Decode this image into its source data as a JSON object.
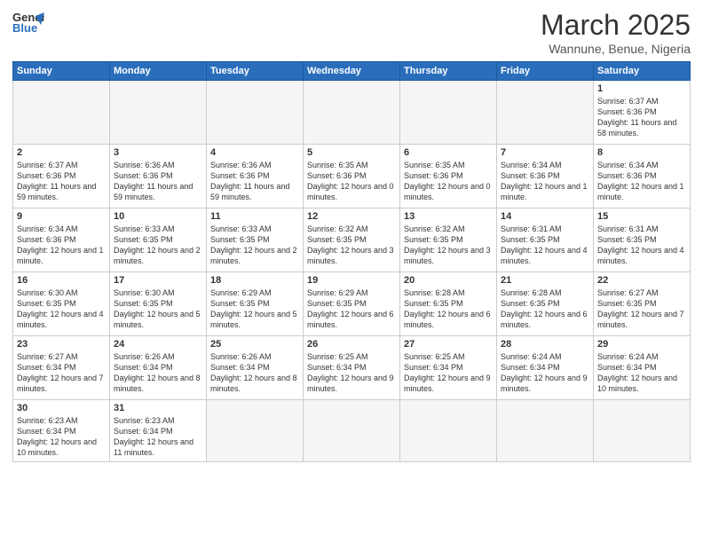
{
  "header": {
    "logo_general": "General",
    "logo_blue": "Blue",
    "month_year": "March 2025",
    "location": "Wannune, Benue, Nigeria"
  },
  "days_of_week": [
    "Sunday",
    "Monday",
    "Tuesday",
    "Wednesday",
    "Thursday",
    "Friday",
    "Saturday"
  ],
  "weeks": [
    [
      {
        "day": "",
        "info": ""
      },
      {
        "day": "",
        "info": ""
      },
      {
        "day": "",
        "info": ""
      },
      {
        "day": "",
        "info": ""
      },
      {
        "day": "",
        "info": ""
      },
      {
        "day": "",
        "info": ""
      },
      {
        "day": "1",
        "info": "Sunrise: 6:37 AM\nSunset: 6:36 PM\nDaylight: 11 hours\nand 58 minutes."
      }
    ],
    [
      {
        "day": "2",
        "info": "Sunrise: 6:37 AM\nSunset: 6:36 PM\nDaylight: 11 hours\nand 59 minutes."
      },
      {
        "day": "3",
        "info": "Sunrise: 6:36 AM\nSunset: 6:36 PM\nDaylight: 11 hours\nand 59 minutes."
      },
      {
        "day": "4",
        "info": "Sunrise: 6:36 AM\nSunset: 6:36 PM\nDaylight: 11 hours\nand 59 minutes."
      },
      {
        "day": "5",
        "info": "Sunrise: 6:35 AM\nSunset: 6:36 PM\nDaylight: 12 hours\nand 0 minutes."
      },
      {
        "day": "6",
        "info": "Sunrise: 6:35 AM\nSunset: 6:36 PM\nDaylight: 12 hours\nand 0 minutes."
      },
      {
        "day": "7",
        "info": "Sunrise: 6:34 AM\nSunset: 6:36 PM\nDaylight: 12 hours\nand 1 minute."
      },
      {
        "day": "8",
        "info": "Sunrise: 6:34 AM\nSunset: 6:36 PM\nDaylight: 12 hours\nand 1 minute."
      }
    ],
    [
      {
        "day": "9",
        "info": "Sunrise: 6:34 AM\nSunset: 6:36 PM\nDaylight: 12 hours\nand 1 minute."
      },
      {
        "day": "10",
        "info": "Sunrise: 6:33 AM\nSunset: 6:35 PM\nDaylight: 12 hours\nand 2 minutes."
      },
      {
        "day": "11",
        "info": "Sunrise: 6:33 AM\nSunset: 6:35 PM\nDaylight: 12 hours\nand 2 minutes."
      },
      {
        "day": "12",
        "info": "Sunrise: 6:32 AM\nSunset: 6:35 PM\nDaylight: 12 hours\nand 3 minutes."
      },
      {
        "day": "13",
        "info": "Sunrise: 6:32 AM\nSunset: 6:35 PM\nDaylight: 12 hours\nand 3 minutes."
      },
      {
        "day": "14",
        "info": "Sunrise: 6:31 AM\nSunset: 6:35 PM\nDaylight: 12 hours\nand 4 minutes."
      },
      {
        "day": "15",
        "info": "Sunrise: 6:31 AM\nSunset: 6:35 PM\nDaylight: 12 hours\nand 4 minutes."
      }
    ],
    [
      {
        "day": "16",
        "info": "Sunrise: 6:30 AM\nSunset: 6:35 PM\nDaylight: 12 hours\nand 4 minutes."
      },
      {
        "day": "17",
        "info": "Sunrise: 6:30 AM\nSunset: 6:35 PM\nDaylight: 12 hours\nand 5 minutes."
      },
      {
        "day": "18",
        "info": "Sunrise: 6:29 AM\nSunset: 6:35 PM\nDaylight: 12 hours\nand 5 minutes."
      },
      {
        "day": "19",
        "info": "Sunrise: 6:29 AM\nSunset: 6:35 PM\nDaylight: 12 hours\nand 6 minutes."
      },
      {
        "day": "20",
        "info": "Sunrise: 6:28 AM\nSunset: 6:35 PM\nDaylight: 12 hours\nand 6 minutes."
      },
      {
        "day": "21",
        "info": "Sunrise: 6:28 AM\nSunset: 6:35 PM\nDaylight: 12 hours\nand 6 minutes."
      },
      {
        "day": "22",
        "info": "Sunrise: 6:27 AM\nSunset: 6:35 PM\nDaylight: 12 hours\nand 7 minutes."
      }
    ],
    [
      {
        "day": "23",
        "info": "Sunrise: 6:27 AM\nSunset: 6:34 PM\nDaylight: 12 hours\nand 7 minutes."
      },
      {
        "day": "24",
        "info": "Sunrise: 6:26 AM\nSunset: 6:34 PM\nDaylight: 12 hours\nand 8 minutes."
      },
      {
        "day": "25",
        "info": "Sunrise: 6:26 AM\nSunset: 6:34 PM\nDaylight: 12 hours\nand 8 minutes."
      },
      {
        "day": "26",
        "info": "Sunrise: 6:25 AM\nSunset: 6:34 PM\nDaylight: 12 hours\nand 9 minutes."
      },
      {
        "day": "27",
        "info": "Sunrise: 6:25 AM\nSunset: 6:34 PM\nDaylight: 12 hours\nand 9 minutes."
      },
      {
        "day": "28",
        "info": "Sunrise: 6:24 AM\nSunset: 6:34 PM\nDaylight: 12 hours\nand 9 minutes."
      },
      {
        "day": "29",
        "info": "Sunrise: 6:24 AM\nSunset: 6:34 PM\nDaylight: 12 hours\nand 10 minutes."
      }
    ],
    [
      {
        "day": "30",
        "info": "Sunrise: 6:23 AM\nSunset: 6:34 PM\nDaylight: 12 hours\nand 10 minutes."
      },
      {
        "day": "31",
        "info": "Sunrise: 6:23 AM\nSunset: 6:34 PM\nDaylight: 12 hours\nand 11 minutes."
      },
      {
        "day": "",
        "info": ""
      },
      {
        "day": "",
        "info": ""
      },
      {
        "day": "",
        "info": ""
      },
      {
        "day": "",
        "info": ""
      },
      {
        "day": "",
        "info": ""
      }
    ]
  ]
}
